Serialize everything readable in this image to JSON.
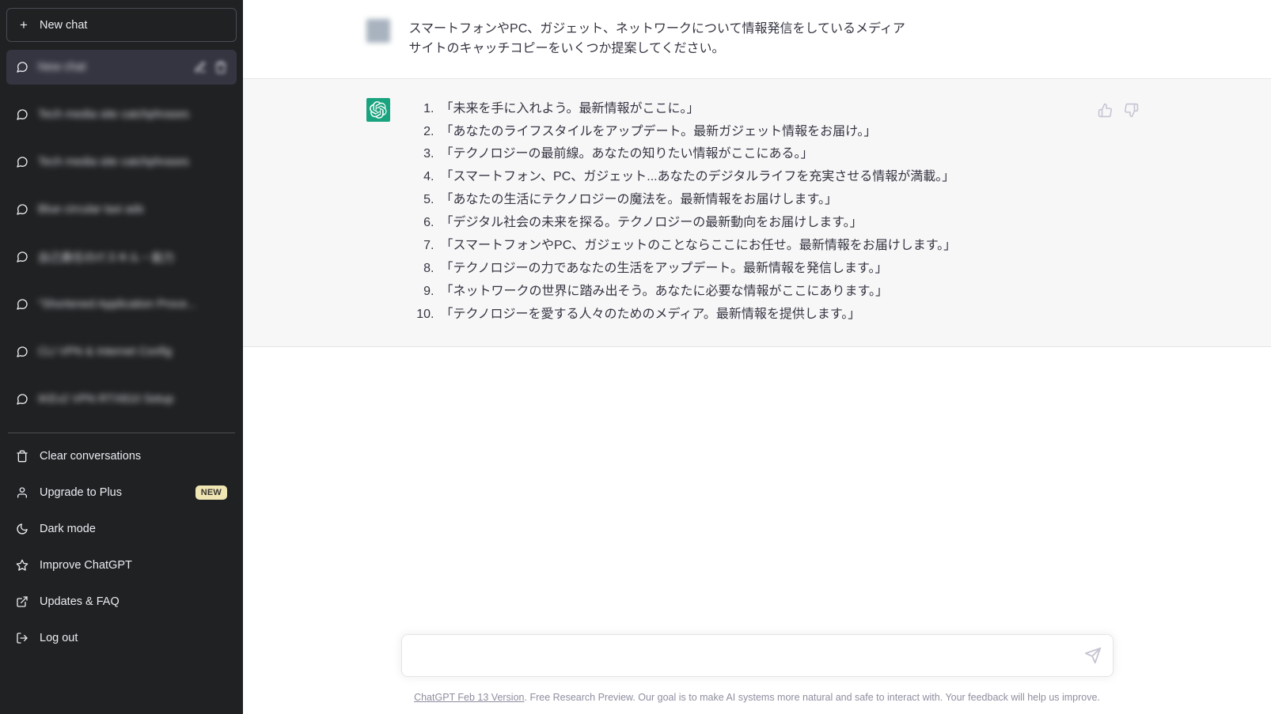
{
  "sidebar": {
    "new_chat_label": "New chat",
    "history": [
      {
        "label": "New chat",
        "active": true,
        "redacted": true
      },
      {
        "label": "Tech media site catchphrases",
        "active": false,
        "redacted": true
      },
      {
        "label": "Tech media site catchphrases",
        "active": false,
        "redacted": true
      },
      {
        "label": "Blue circular taxi ads",
        "active": false,
        "redacted": true
      },
      {
        "label": "自己責任のITスキル・能力",
        "active": false,
        "redacted": true
      },
      {
        "label": "\"Shortened Application Proce...",
        "active": false,
        "redacted": true
      },
      {
        "label": "CLI VPN & Internet Config",
        "active": false,
        "redacted": true
      },
      {
        "label": "IKEv2 VPN RTX810 Setup",
        "active": false,
        "redacted": true
      }
    ],
    "menu": [
      {
        "label": "Clear conversations",
        "icon": "trash-icon",
        "badge": null
      },
      {
        "label": "Upgrade to Plus",
        "icon": "user-icon",
        "badge": "NEW"
      },
      {
        "label": "Dark mode",
        "icon": "moon-icon",
        "badge": null
      },
      {
        "label": "Improve ChatGPT",
        "icon": "star-icon",
        "badge": null
      },
      {
        "label": "Updates & FAQ",
        "icon": "external-link-icon",
        "badge": null
      },
      {
        "label": "Log out",
        "icon": "logout-icon",
        "badge": null
      }
    ]
  },
  "conversation": {
    "user_message": "スマートフォンやPC、ガジェット、ネットワークについて情報発信をしているメディアサイトのキャッチコピーをいくつか提案してください。",
    "assistant_items": [
      "「未来を手に入れよう。最新情報がここに。」",
      "「あなたのライフスタイルをアップデート。最新ガジェット情報をお届け。」",
      "「テクノロジーの最前線。あなたの知りたい情報がここにある。」",
      "「スマートフォン、PC、ガジェット...あなたのデジタルライフを充実させる情報が満載。」",
      "「あなたの生活にテクノロジーの魔法を。最新情報をお届けします。」",
      "「デジタル社会の未来を探る。テクノロジーの最新動向をお届けします。」",
      "「スマートフォンやPC、ガジェットのことならここにお任せ。最新情報をお届けします。」",
      "「テクノロジーの力であなたの生活をアップデート。最新情報を発信します。」",
      "「ネットワークの世界に踏み出そう。あなたに必要な情報がここにあります。」",
      "「テクノロジーを愛する人々のためのメディア。最新情報を提供します。」"
    ]
  },
  "composer": {
    "value": "",
    "placeholder": "",
    "send_icon": "send-icon"
  },
  "footer": {
    "link_text": "ChatGPT Feb 13 Version",
    "rest_text": ". Free Research Preview. Our goal is to make AI systems more natural and safe to interact with. Your feedback will help us improve."
  },
  "colors": {
    "sidebar_bg": "#202123",
    "active_item": "#343541",
    "assistant_bg": "#f7f7f8",
    "brand_green": "#19a37f",
    "badge_yellow": "#f0e6b4"
  }
}
